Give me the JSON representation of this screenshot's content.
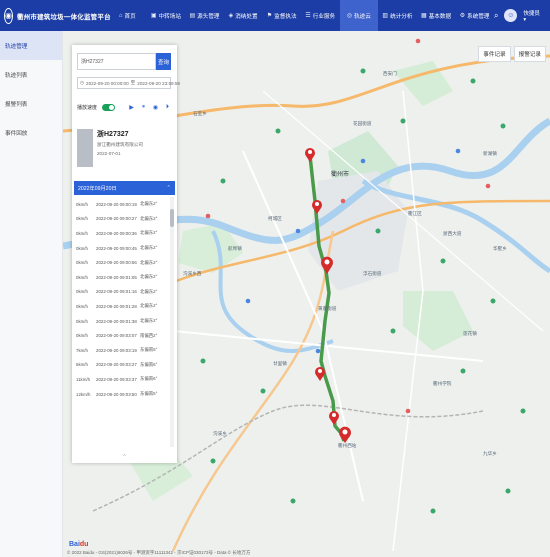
{
  "app": {
    "title": "衢州市建筑垃圾一体化监管平台"
  },
  "nav": [
    {
      "label": "首页",
      "icon": "home-icon",
      "glyph": "⌂"
    },
    {
      "label": "中转场站",
      "icon": "station-icon",
      "glyph": "▣"
    },
    {
      "label": "源头管理",
      "icon": "source-icon",
      "glyph": "▤"
    },
    {
      "label": "消纳处置",
      "icon": "disposal-icon",
      "glyph": "◈"
    },
    {
      "label": "监督执法",
      "icon": "enforce-icon",
      "glyph": "⚑"
    },
    {
      "label": "行业服务",
      "icon": "service-icon",
      "glyph": "☰"
    },
    {
      "label": "轨迹云",
      "icon": "track-icon",
      "glyph": "◎",
      "active": true
    },
    {
      "label": "统计分析",
      "icon": "stats-icon",
      "glyph": "▥"
    },
    {
      "label": "基本数据",
      "icon": "data-icon",
      "glyph": "▦"
    },
    {
      "label": "系统管理",
      "icon": "settings-icon",
      "glyph": "⚙"
    }
  ],
  "user": {
    "name": "快捷员 ▾"
  },
  "sidebar": [
    {
      "label": "轨迹管理",
      "active": true
    },
    {
      "label": "轨迹列表"
    },
    {
      "label": "报警列表"
    },
    {
      "label": "事件回放"
    }
  ],
  "panel": {
    "search_value": "浙H27327",
    "search_btn": "查询",
    "date_start": "2022-09-20 00:00:00",
    "date_sep": "至",
    "date_end": "2022-09-20 23:59:59",
    "toggle_label": "播放速度",
    "vehicle": {
      "plate": "浙H27327",
      "company": "浙江衢州建筑有限公司",
      "date": "2022-07-01"
    },
    "group_date": "2022年09月20日",
    "rows": [
      {
        "speed": "0km/h",
        "time": "2022-09-20 09:00:19",
        "dir": "北偏东2°"
      },
      {
        "speed": "0km/h",
        "time": "2022-09-20 09:00:27",
        "dir": "北偏东2°"
      },
      {
        "speed": "0km/h",
        "time": "2022-09-20 09:00:36",
        "dir": "北偏东2°"
      },
      {
        "speed": "0km/h",
        "time": "2022-09-20 09:00:45",
        "dir": "北偏东2°"
      },
      {
        "speed": "0km/h",
        "time": "2022-09-20 09:00:56",
        "dir": "北偏东2°"
      },
      {
        "speed": "0km/h",
        "time": "2022-09-20 09:01:05",
        "dir": "北偏东2°"
      },
      {
        "speed": "0km/h",
        "time": "2022-09-20 09:01:16",
        "dir": "北偏东2°"
      },
      {
        "speed": "0km/h",
        "time": "2022-09-20 09:01:28",
        "dir": "北偏东2°"
      },
      {
        "speed": "0km/h",
        "time": "2022-09-20 09:01:38",
        "dir": "北偏东2°"
      },
      {
        "speed": "0km/h",
        "time": "2022-09-20 09:03:07",
        "dir": "南偏西2°"
      },
      {
        "speed": "7km/h",
        "time": "2022-09-20 09:03:19",
        "dir": "东偏南5°"
      },
      {
        "speed": "6km/h",
        "time": "2022-09-20 09:03:27",
        "dir": "东偏南6°"
      },
      {
        "speed": "11km/h",
        "time": "2022-09-20 09:03:37",
        "dir": "东偏南6°"
      },
      {
        "speed": "12km/h",
        "time": "2022-09-20 09:03:50",
        "dir": "东偏南5°"
      }
    ],
    "foot": "^"
  },
  "map": {
    "buttons": [
      "事件记录",
      "报警记录"
    ],
    "labels": [
      "衢州市",
      "西安门",
      "柯城区",
      "衢江区",
      "新湖镇",
      "石室乡",
      "莲花镇",
      "航埠镇",
      "沟溪乡",
      "花园街道",
      "浮石街道",
      "黄家街道",
      "廿里镇",
      "衢州西站",
      "衢州学院",
      "浙西大道",
      "九华乡",
      "华墅乡",
      "沟溪乡西"
    ],
    "copyright": "© 2022 Baidu - GS(2021)6026号 - 甲测资字11111342 - 京ICP证030173号 - Data © 长地万方",
    "logo_a": "Bai",
    "logo_b": "du"
  },
  "colors": {
    "brand": "#1b3da5",
    "track": "#4a9a4c",
    "pin": "#d62b2b"
  }
}
